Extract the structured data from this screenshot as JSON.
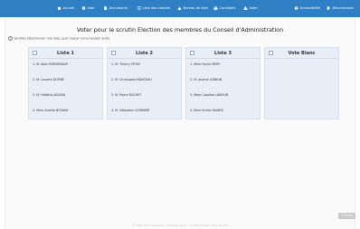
{
  "nav": {
    "items": [
      {
        "label": "Accueil",
        "icon": "home-icon"
      },
      {
        "label": "Aide",
        "icon": "help-icon"
      },
      {
        "label": "Documents",
        "icon": "document-icon"
      },
      {
        "label": "Liste des votants",
        "icon": "list-icon"
      },
      {
        "label": "Bureau de vote",
        "icon": "ballot-box-icon"
      },
      {
        "label": "Candidats",
        "icon": "people-icon"
      },
      {
        "label": "Voter",
        "icon": "vote-icon"
      }
    ],
    "accessibility_label": "Accessibilité",
    "logout_label": "Déconnexion",
    "bar_color": "#2e7fc4"
  },
  "page": {
    "title": "Voter pour le scrutin Election des membres du Conseil d'Administration",
    "instructions": "Veuillez sélectionner une liste, puis cliquer sur le bouton Suite.",
    "help_glyph": "?"
  },
  "lists": [
    {
      "title": "Liste 1",
      "candidates": [
        "1. M. Alain BORDENAVE",
        "2. M. Laurent DUPIRE",
        "3. M. Frédéric JAOUEN",
        "4. Mme Aurelie NOVAKK"
      ]
    },
    {
      "title": "Liste 2",
      "candidates": [
        "1. M. Thierry PITON",
        "2. M. Christophe MANCEAU",
        "3. M. Pierre ROCHET",
        "4. M. Sébastien GOMBERT"
      ]
    },
    {
      "title": "Liste 3",
      "candidates": [
        "1. Mme Sylvie MERY",
        "2. M. Jerome LEBRUN",
        "3. Mme Caroline LAMOUR",
        "4. Mme Emilie FAVARO"
      ]
    },
    {
      "title": "Vote Blanc",
      "candidates": []
    }
  ],
  "next_button": {
    "label": "Suite",
    "icon": "arrow-right-icon"
  },
  "footer": "© 2007-2017 Gaspareo · Donnees libres · Confidentialité · Plan du site"
}
